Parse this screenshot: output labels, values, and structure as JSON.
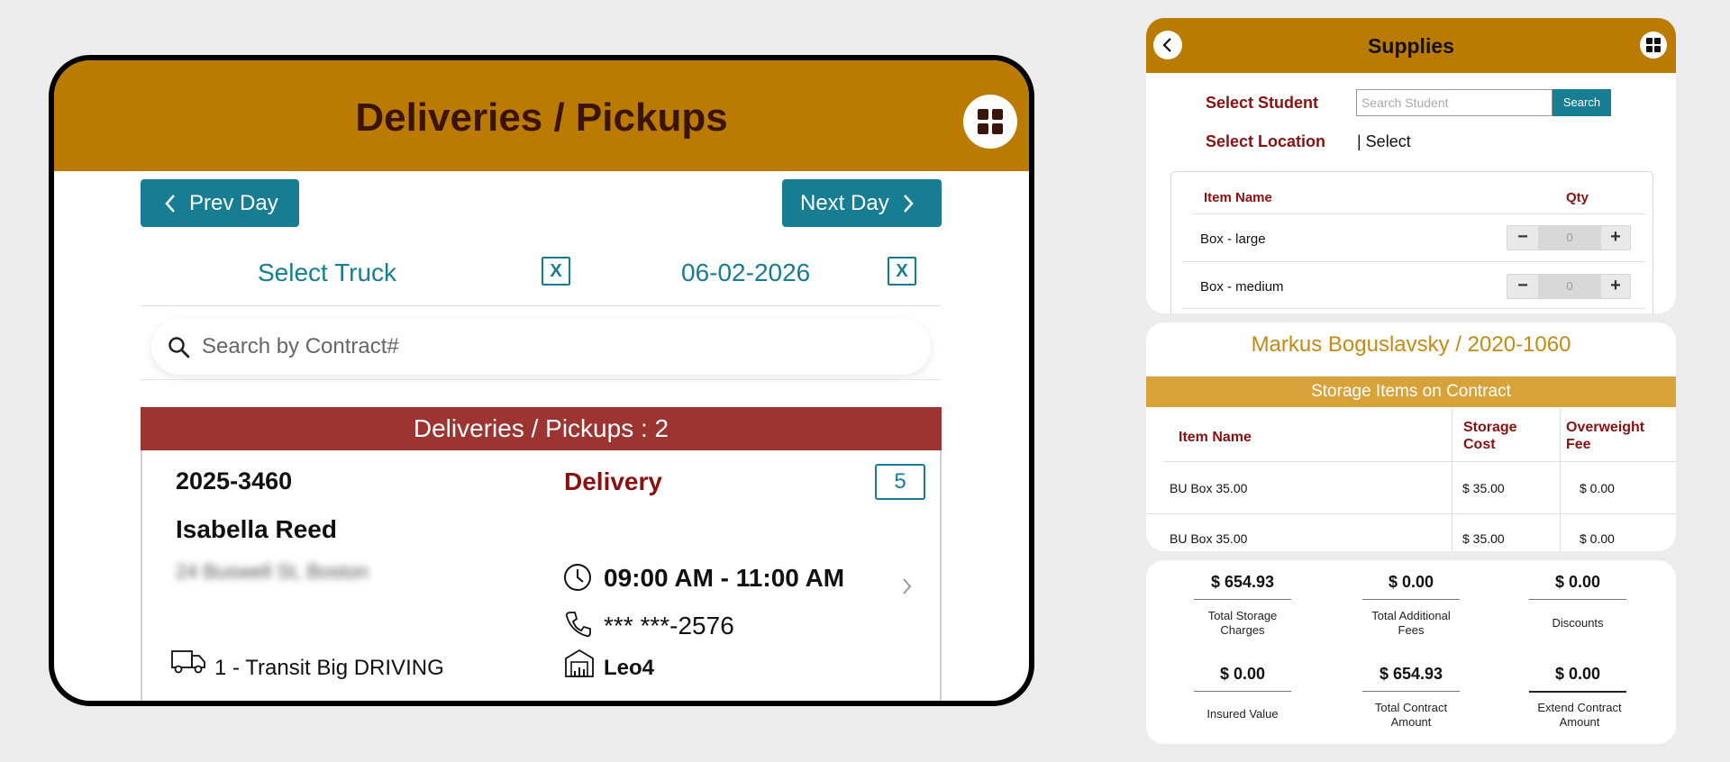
{
  "deliveries": {
    "title": "Deliveries / Pickups",
    "prev_label": "Prev Day",
    "next_label": "Next Day",
    "select_truck": "Select Truck",
    "date": "06-02-2026",
    "clear_label": "X",
    "search_placeholder": "Search by Contract#",
    "list_header": "Deliveries / Pickups : 2",
    "card": {
      "contract": "2025-3460",
      "type": "Delivery",
      "count": "5",
      "name": "Isabella Reed",
      "address": "24 Buswell St, Boston",
      "time": "09:00 AM - 11:00 AM",
      "phone": "*** ***-2576",
      "truck": "1 - Transit Big  DRIVING",
      "location": "Leo4"
    }
  },
  "supplies": {
    "title": "Supplies",
    "select_student_label": "Select Student",
    "search_placeholder": "Search Student",
    "search_button": "Search",
    "select_location_label": "Select Location",
    "location_value": "| Select",
    "col_item": "Item Name",
    "col_qty": "Qty",
    "items": [
      {
        "name": "Box - large",
        "qty": "0"
      },
      {
        "name": "Box - medium",
        "qty": "0"
      }
    ]
  },
  "contract": {
    "title": "Markus Boguslavsky / 2020-1060",
    "banner": "Storage Items on Contract",
    "col_item": "Item Name",
    "col_cost_1": "Storage",
    "col_cost_2": "Cost",
    "col_fee_1": "Overweight",
    "col_fee_2": "Fee",
    "rows": [
      {
        "item": "BU Box 35.00",
        "cost": "$ 35.00",
        "fee": "$ 0.00"
      },
      {
        "item": "BU Box 35.00",
        "cost": "$ 35.00",
        "fee": "$ 0.00"
      }
    ]
  },
  "totals": [
    {
      "value": "$ 654.93",
      "label_1": "Total  Storage",
      "label_2": "Charges"
    },
    {
      "value": "$ 0.00",
      "label_1": "Total Additional",
      "label_2": "Fees"
    },
    {
      "value": "$ 0.00",
      "label_1": "Discounts",
      "label_2": ""
    },
    {
      "value": "$ 0.00",
      "label_1": "Insured Value",
      "label_2": ""
    },
    {
      "value": "$ 654.93",
      "label_1": "Total Contract",
      "label_2": "Amount"
    },
    {
      "value": "$ 0.00",
      "label_1": "Extend Contract",
      "label_2": "Amount"
    }
  ],
  "colors": {
    "header_gold": "#ba7b00",
    "teal": "#167d92",
    "banner_red": "#9c3431",
    "label_maroon": "#8a1111",
    "contract_gold": "#d8a23a"
  },
  "icons": [
    "grid-icon",
    "chevron-left-icon",
    "chevron-right-icon",
    "search-icon",
    "clock-icon",
    "phone-icon",
    "truck-icon",
    "warehouse-icon",
    "back-icon",
    "minus-icon",
    "plus-icon"
  ]
}
